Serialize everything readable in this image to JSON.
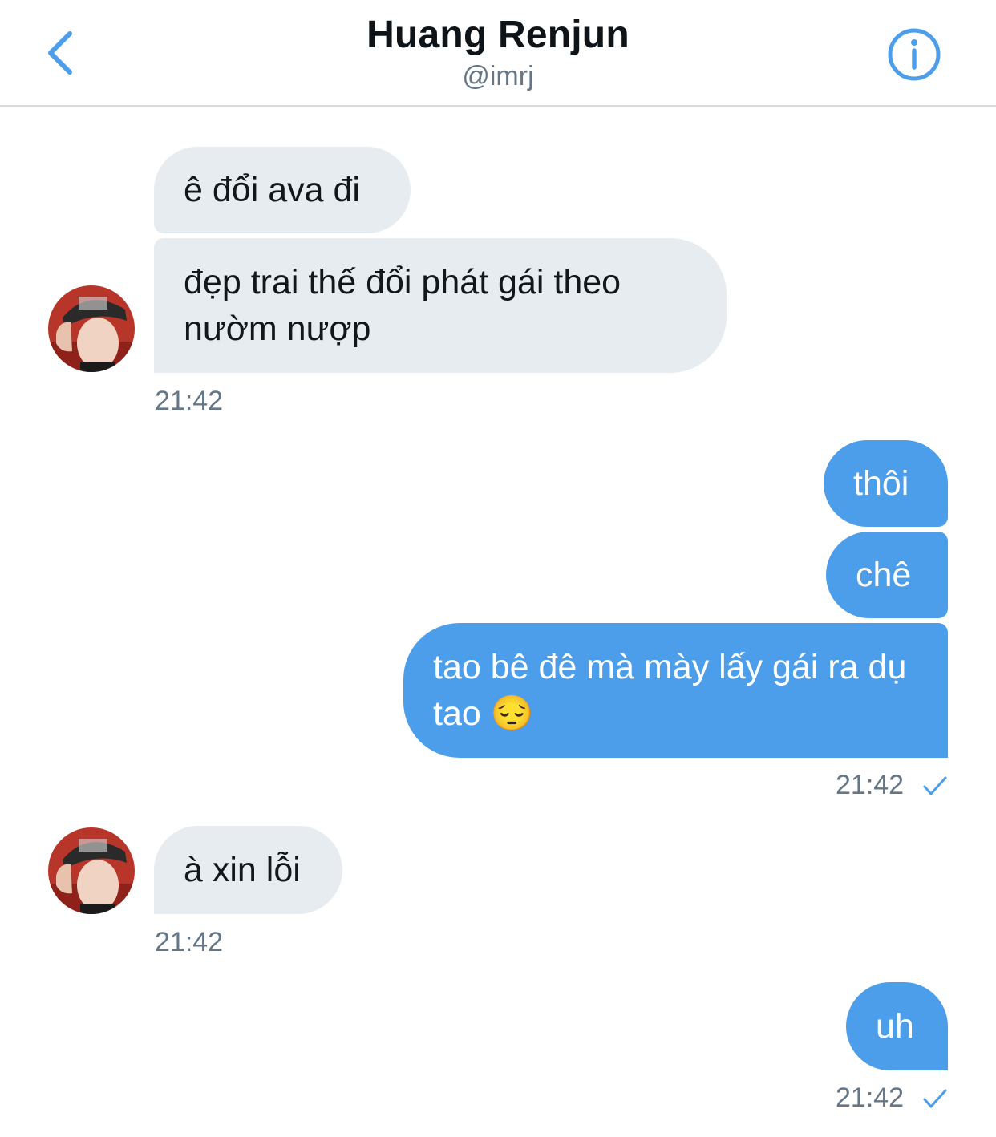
{
  "header": {
    "back_icon": "chevron-left-icon",
    "title": "Huang Renjun",
    "handle": "@imrj",
    "info_icon": "info-icon",
    "accent_color": "#4c9eea"
  },
  "messages": [
    {
      "direction": "incoming",
      "text": "ê đổi ava đi"
    },
    {
      "direction": "incoming",
      "text": "đẹp trai thế đổi phát gái theo nườm nượp",
      "time": "21:42"
    },
    {
      "direction": "outgoing",
      "text": "thôi"
    },
    {
      "direction": "outgoing",
      "text": "chê"
    },
    {
      "direction": "outgoing",
      "text": "tao bê đê mà mày lấy gái ra dụ tao 😔",
      "time": "21:42",
      "status_icon": "check-icon"
    },
    {
      "direction": "incoming",
      "text": "à xin lỗi",
      "time": "21:42"
    },
    {
      "direction": "outgoing",
      "text": "uh",
      "time": "21:42",
      "status_icon": "check-icon"
    }
  ],
  "colors": {
    "incoming_bubble": "#e6ecf0",
    "outgoing_bubble": "#4c9eea",
    "timestamp": "#657786"
  }
}
